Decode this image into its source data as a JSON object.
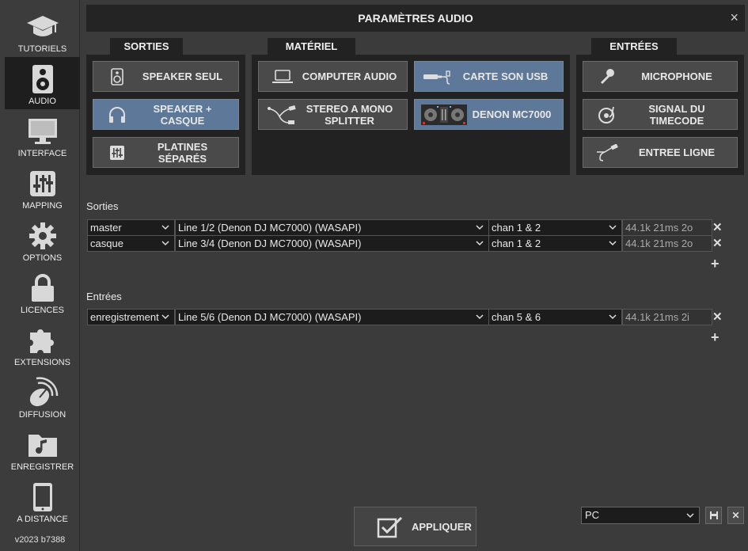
{
  "sidebar": {
    "items": [
      {
        "label": "TUTORIELS",
        "icon": "graduation-cap-icon"
      },
      {
        "label": "AUDIO",
        "icon": "speaker-icon"
      },
      {
        "label": "INTERFACE",
        "icon": "monitor-icon"
      },
      {
        "label": "MAPPING",
        "icon": "sliders-icon"
      },
      {
        "label": "OPTIONS",
        "icon": "gear-icon"
      },
      {
        "label": "LICENCES",
        "icon": "lock-icon"
      },
      {
        "label": "EXTENSIONS",
        "icon": "puzzle-icon"
      },
      {
        "label": "DIFFUSION",
        "icon": "satellite-dish-icon"
      },
      {
        "label": "ENREGISTRER",
        "icon": "music-folder-icon"
      },
      {
        "label": "A DISTANCE",
        "icon": "tablet-icon"
      }
    ],
    "active": "AUDIO",
    "version": "v2023 b7388"
  },
  "dialog": {
    "title": "PARAMÈTRES AUDIO",
    "close": "×"
  },
  "groups": {
    "sorties": {
      "tab": "SORTIES",
      "buttons": [
        {
          "label": "SPEAKER SEUL",
          "icon": "speaker-icon",
          "selected": false
        },
        {
          "label": "SPEAKER + CASQUE",
          "icon": "headphones-icon",
          "selected": true
        },
        {
          "label": "PLATINES SÉPARÉS",
          "icon": "mixer-icon",
          "selected": false
        }
      ]
    },
    "materiel": {
      "tab": "MATÉRIEL",
      "buttons": [
        {
          "label": "COMPUTER AUDIO",
          "icon": "laptop-icon",
          "selected": false
        },
        {
          "label": "CARTE SON USB",
          "icon": "usb-soundcard-icon",
          "selected": true
        },
        {
          "label": "STEREO A MONO SPLITTER",
          "icon": "splitter-cable-icon",
          "selected": false
        },
        {
          "label": "DENON MC7000",
          "icon": "controller-image",
          "selected": true
        }
      ]
    },
    "entrees": {
      "tab": "ENTRÉES",
      "buttons": [
        {
          "label": "MICROPHONE",
          "icon": "microphone-icon",
          "selected": false
        },
        {
          "label": "SIGNAL DU TIMECODE",
          "icon": "turntable-icon",
          "selected": false
        },
        {
          "label": "ENTREE LIGNE",
          "icon": "jack-cable-icon",
          "selected": false
        }
      ]
    }
  },
  "outputs": {
    "label": "Sorties",
    "rows": [
      {
        "role": "master",
        "device": "Line 1/2 (Denon DJ MC7000) (WASAPI)",
        "channel": "chan 1 & 2",
        "info": "44.1k 21ms 2o"
      },
      {
        "role": "casque",
        "device": "Line 3/4 (Denon DJ MC7000) (WASAPI)",
        "channel": "chan 1 & 2",
        "info": "44.1k 21ms 2o"
      }
    ]
  },
  "inputs": {
    "label": "Entrées",
    "rows": [
      {
        "role": "enregistrement",
        "device": "Line 5/6 (Denon DJ MC7000) (WASAPI)",
        "channel": "chan 5 & 6",
        "info": "44.1k 21ms 2i"
      }
    ]
  },
  "footer": {
    "apply_label": "APPLIQUER",
    "preset_value": "PC"
  },
  "colors": {
    "selected_button": "#5d7898",
    "panel": "#222222",
    "background": "#3a3a3a"
  }
}
